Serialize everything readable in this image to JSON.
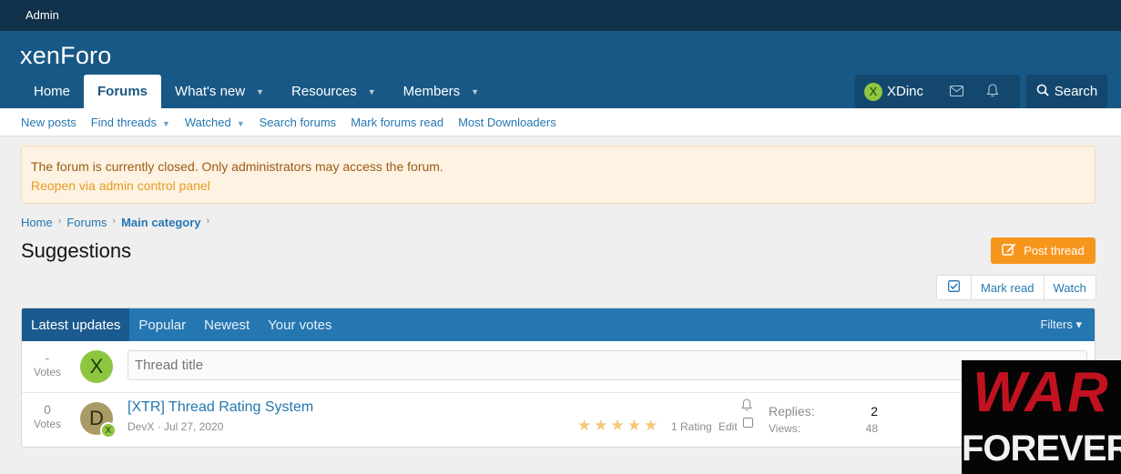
{
  "admin_bar": {
    "label": "Admin"
  },
  "header": {
    "logo": "xenForo",
    "nav": [
      {
        "label": "Home",
        "active": false,
        "dropdown": false
      },
      {
        "label": "Forums",
        "active": true,
        "dropdown": false
      },
      {
        "label": "What's new",
        "active": false,
        "dropdown": true
      },
      {
        "label": "Resources",
        "active": false,
        "dropdown": true
      },
      {
        "label": "Members",
        "active": false,
        "dropdown": true
      }
    ],
    "user": {
      "initial": "X",
      "name": "XDinc"
    },
    "search_label": "Search"
  },
  "subnav": [
    "New posts",
    "Find threads",
    "Watched",
    "Search forums",
    "Mark forums read",
    "Most Downloaders"
  ],
  "notice": {
    "message": "The forum is currently closed. Only administrators may access the forum.",
    "link": "Reopen via admin control panel"
  },
  "breadcrumb": [
    "Home",
    "Forums",
    "Main category"
  ],
  "page_title": "Suggestions",
  "actions": {
    "post_thread": "Post thread",
    "mark_read": "Mark read",
    "watch": "Watch"
  },
  "tabs": [
    "Latest updates",
    "Popular",
    "Newest",
    "Your votes"
  ],
  "filters_label": "Filters",
  "new_thread": {
    "votes": "-",
    "votes_label": "Votes",
    "avatar": "X",
    "placeholder": "Thread title"
  },
  "threads": [
    {
      "votes": "0",
      "votes_label": "Votes",
      "avatar": "D",
      "avatar_badge": "X",
      "title": "[XTR] Thread Rating System",
      "author_date": "DevX · Jul 27, 2020",
      "rating_count": "1 Rating",
      "rating_value": 5,
      "edit": "Edit",
      "replies_label": "Replies:",
      "replies": "2",
      "views_label": "Views:",
      "views": "48"
    }
  ],
  "watermark": {
    "line1": "WAR",
    "line2": "FOREVER"
  }
}
